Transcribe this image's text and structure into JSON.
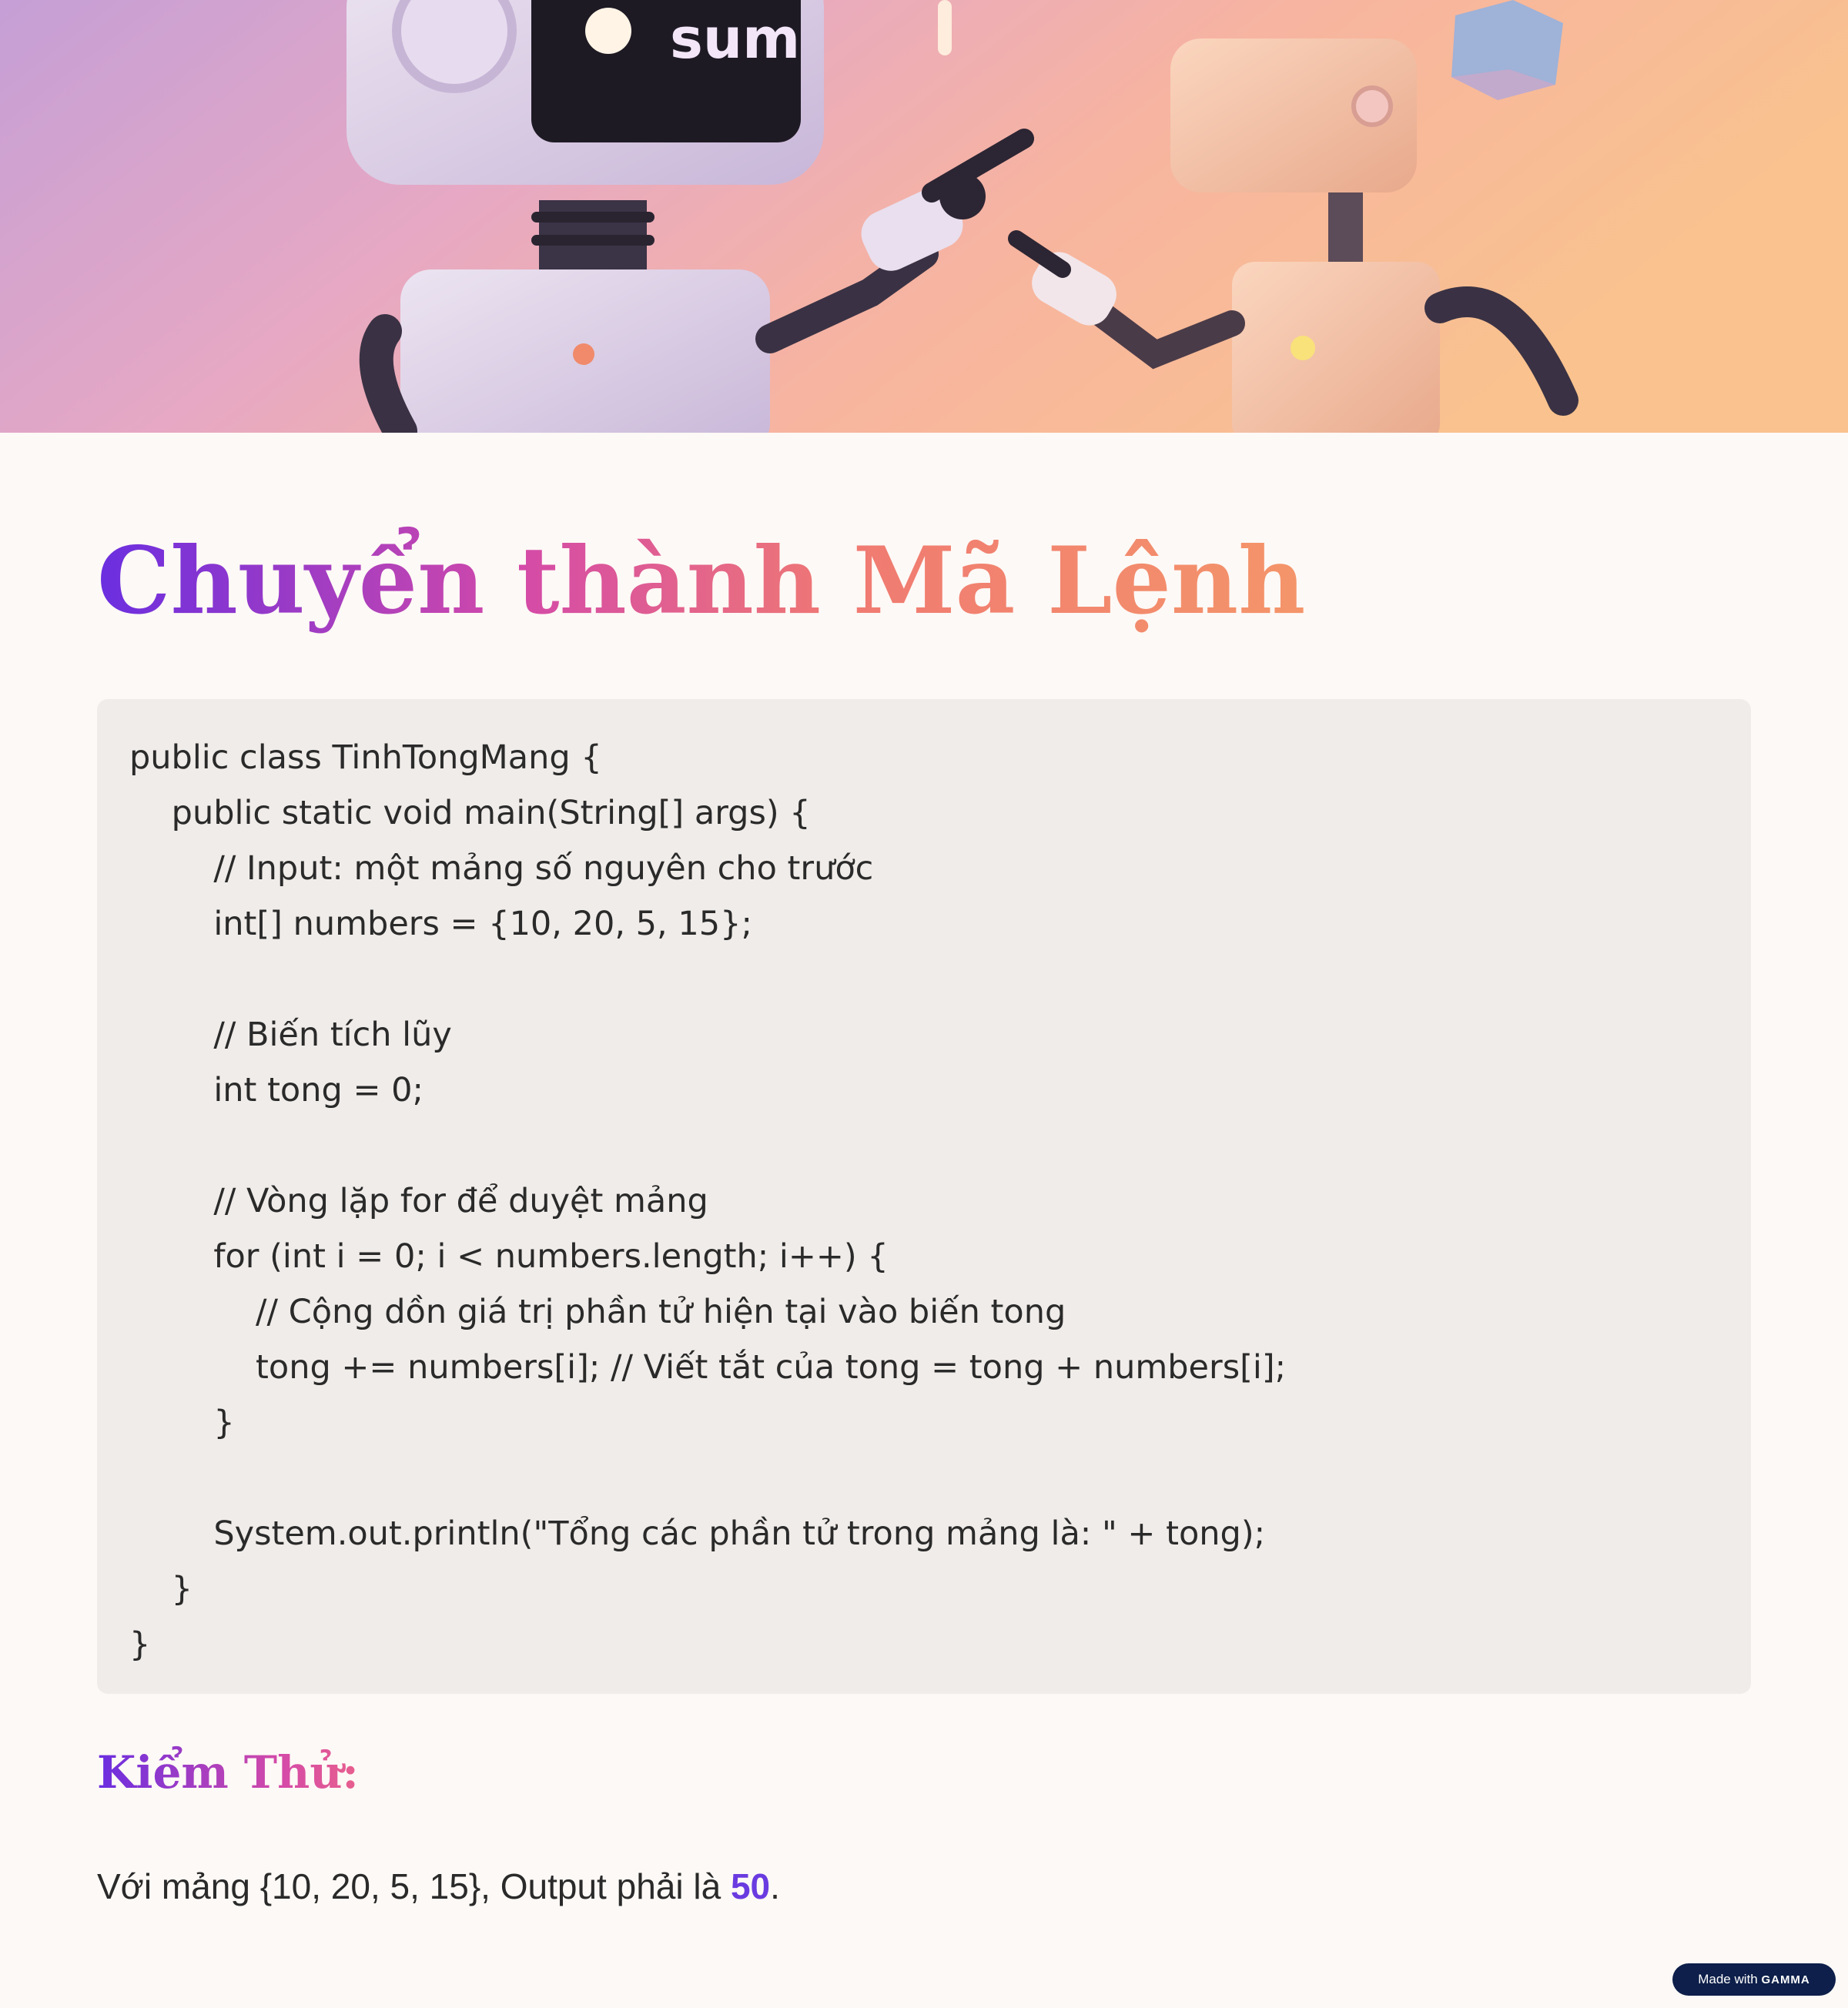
{
  "hero": {
    "screen_text": "sum"
  },
  "title": "Chuyển thành Mã Lệnh",
  "code_lines": [
    "public class TinhTongMang {",
    "    public static void main(String[] args) {",
    "        // Input: một mảng số nguyên cho trước",
    "        int[] numbers = {10, 20, 5, 15};",
    "",
    "        // Biến tích lũy",
    "        int tong = 0;",
    "",
    "        // Vòng lặp for để duyệt mảng",
    "        for (int i = 0; i < numbers.length; i++) {",
    "            // Cộng dồn giá trị phần tử hiện tại vào biến tong",
    "            tong += numbers[i]; // Viết tắt của tong = tong + numbers[i];",
    "        }",
    "",
    "        System.out.println(\"Tổng các phần tử trong mảng là: \" + tong);",
    "    }",
    "}"
  ],
  "test": {
    "heading": "Kiểm Thử:",
    "text_before": "Với mảng {10, 20, 5, 15}, Output phải là ",
    "highlight": "50",
    "text_after": "."
  },
  "badge": {
    "prefix": "Made with ",
    "brand": "GAMMA"
  },
  "colors": {
    "page_background": "#fdf9f6",
    "code_background": "#f0ece9",
    "accent_purple": "#6a3be0",
    "accent_pink": "#d44aa8",
    "accent_coral": "#f4956a",
    "badge_background": "#0d1f4a"
  }
}
